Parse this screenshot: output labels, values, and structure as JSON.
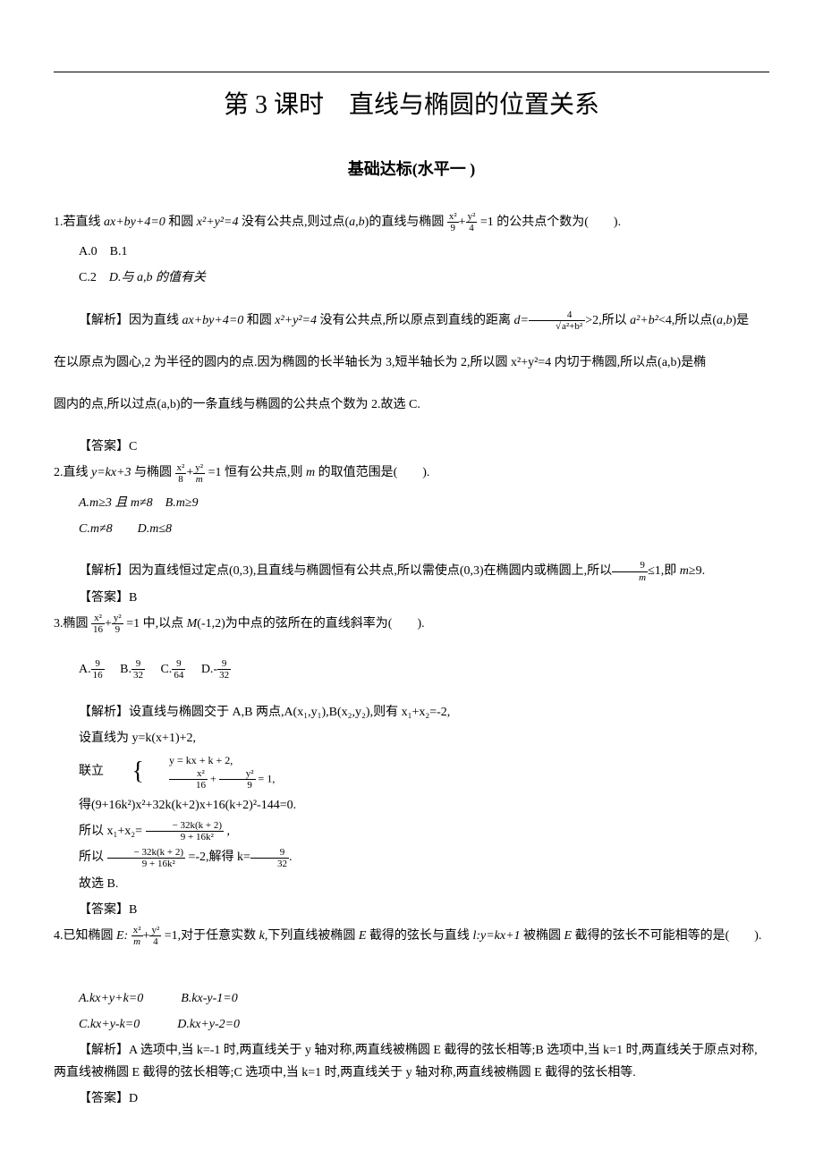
{
  "header": {
    "title": "第 3 课时　直线与椭圆的位置关系",
    "subtitle": "基础达标(水平一 )"
  },
  "q1": {
    "stem_a": "1.若直线 ",
    "stem_b": " 和圆 ",
    "stem_c": " 没有公共点,则过点(",
    "stem_d": ")的直线与椭圆",
    "stem_e": "=1 的公共点个数为(　　).",
    "line_eq": "ax+by+4=0",
    "circle_eq": "x²+y²=4",
    "ab": "a,b",
    "optA": "A.0",
    "optB": "B.1",
    "optC": "C.2",
    "optD": "D.与 a,b 的值有关",
    "expl_a": "【解析】因为直线 ",
    "expl_b": " 和圆 ",
    "expl_c": " 没有公共点,所以原点到直线的距离 ",
    "expl_d": ">2,所以 ",
    "expl_e": "<4,所以点(",
    "expl_f": ")是",
    "d_eq": "d=",
    "ab2": "a²+b²",
    "expl2": "在以原点为圆心,2 为半径的圆内的点.因为椭圆的长半轴长为 3,短半轴长为 2,所以圆 x²+y²=4 内切于椭圆,所以点(a,b)是椭",
    "expl3": "圆内的点,所以过点(a,b)的一条直线与椭圆的公共点个数为 2.故选 C.",
    "answer": "【答案】C"
  },
  "q2": {
    "stem_a": "2.直线 ",
    "stem_b": " 与椭圆",
    "stem_c": "=1 恒有公共点,则 ",
    "stem_d": " 的取值范围是(　　).",
    "line_eq": "y=kx+3",
    "m": "m",
    "optA": "A.m≥3 且 m≠8",
    "optB": "B.m≥9",
    "optC": "C.m≠8",
    "optD": "D.m≤8",
    "expl_a": "【解析】因为直线恒过定点(0,3),且直线与椭圆恒有公共点,所以需使点(0,3)在椭圆内或椭圆上,所以",
    "expl_b": "≤1,即 ",
    "expl_c": "≥9.",
    "answer": "【答案】B"
  },
  "q3": {
    "stem_a": "3.椭圆",
    "stem_b": "=1 中,以点 ",
    "stem_c": "(-1,2)为中点的弦所在的直线斜率为(　　).",
    "M": "M",
    "optA_pre": "A.",
    "optB_pre": "B.",
    "optC_pre": "C.",
    "optD_pre": "D.-",
    "expl1": "【解析】设直线与椭圆交于 A,B 两点,A(x₁,y₁),B(x₂,y₂),则有 x₁+x₂=-2,",
    "expl2": "设直线为 y=k(x+1)+2,",
    "expl3_a": "联立",
    "sys1": "y = kx + k + 2,",
    "sys2_frac1_num": "x²",
    "sys2_frac1_den": "16",
    "sys2_frac2_num": "y²",
    "sys2_frac2_den": "9",
    "sys2_tail": " = 1,",
    "sys2_plus": " + ",
    "expl4": "得(9+16k²)x²+32k(k+2)x+16(k+2)²-144=0.",
    "expl5_a": "所以 x₁+x₂= ",
    "expl5_b": " ,",
    "expl6_a": "所以 ",
    "expl6_b": " =-2,解得 k=",
    "expl6_c": ".",
    "frac_neg32_num": "− 32k(k + 2)",
    "frac_neg32_den": "9 + 16k²",
    "frac_932_num": "9",
    "frac_932_den": "32",
    "expl7": "故选 B.",
    "answer": "【答案】B"
  },
  "q4": {
    "stem_a": "4.已知椭圆 ",
    "stem_b": "=1,对于任意实数 ",
    "stem_c": ",下列直线被椭圆 ",
    "stem_d": " 截得的弦长与直线 ",
    "stem_e": " 被椭圆 ",
    "stem_f": " 截得的弦长不可能相等的是(　　).",
    "E": "E:",
    "Ep": "E",
    "k": "k",
    "l": "l:y=kx+1",
    "optA": "A.kx+y+k=0",
    "optB": "B.kx-y-1=0",
    "optC": "C.kx+y-k=0",
    "optD": "D.kx+y-2=0",
    "expl": "【解析】A 选项中,当 k=-1 时,两直线关于 y 轴对称,两直线被椭圆 E 截得的弦长相等;B 选项中,当 k=1 时,两直线关于原点对称,两直线被椭圆 E 截得的弦长相等;C 选项中,当 k=1 时,两直线关于 y 轴对称,两直线被椭圆 E 截得的弦长相等.",
    "answer": "【答案】D"
  },
  "fractions": {
    "x2_9": {
      "num": "x²",
      "den": "9"
    },
    "y2_4": {
      "num": "y²",
      "den": "4"
    },
    "four": {
      "num": "4",
      "den": ""
    },
    "x2_8": {
      "num": "x²",
      "den": "8"
    },
    "y2_m": {
      "num": "y²",
      "den": "m"
    },
    "nine_m": {
      "num": "9",
      "den": "m"
    },
    "x2_16": {
      "num": "x²",
      "den": "16"
    },
    "y2_9": {
      "num": "y²",
      "den": "9"
    },
    "nine_16": {
      "num": "9",
      "den": "16"
    },
    "nine_32": {
      "num": "9",
      "den": "32"
    },
    "nine_64": {
      "num": "9",
      "den": "64"
    },
    "x2_m": {
      "num": "x²",
      "den": "m"
    }
  },
  "glue": {
    "plus": "+"
  }
}
